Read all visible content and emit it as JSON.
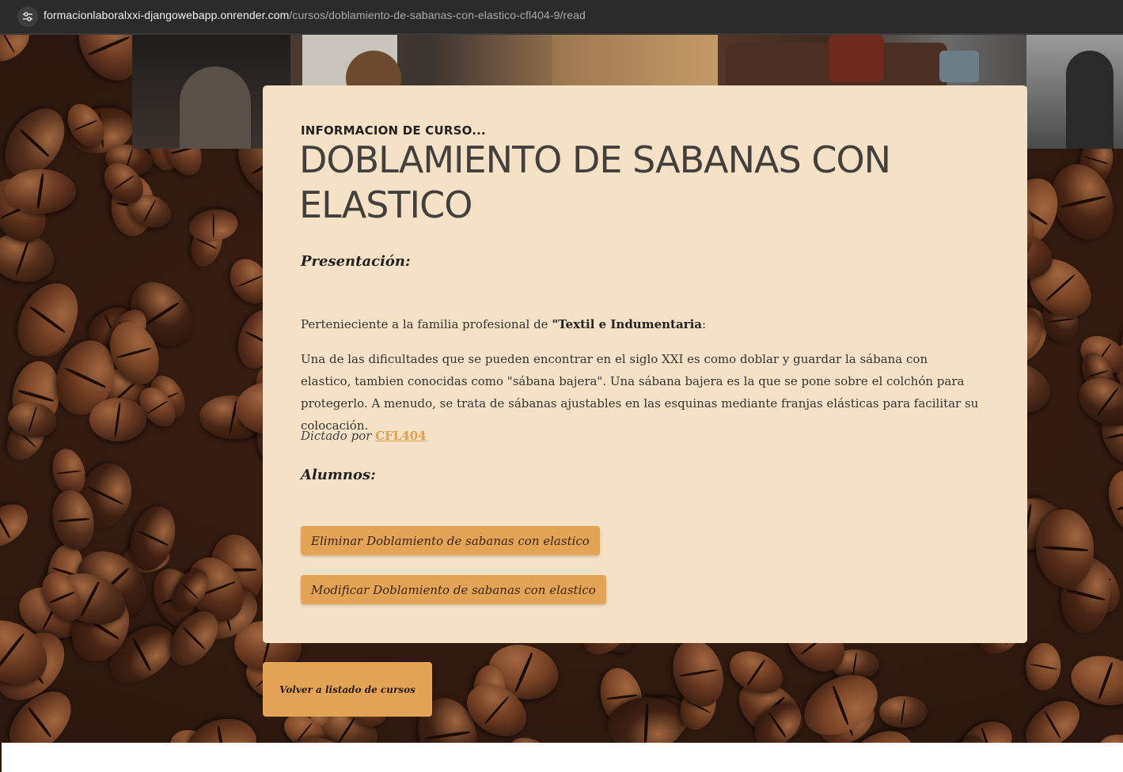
{
  "browser": {
    "url_host": "formacionlaboralxxi-djangowebapp.onrender.com",
    "url_path": "/cursos/doblamiento-de-sabanas-con-elastico-cfl404-9/read"
  },
  "course": {
    "eyebrow": "INFORMACION DE CURSO...",
    "title": "DOBLAMIENTO DE SABANAS CON ELASTICO",
    "presentation_heading": "Presentación:",
    "family_prefix": "Pertenieciente a la familia profesional de ",
    "family_name": "\"Textil e Indumentaria",
    "family_suffix": ":",
    "description": "Una de las dificultades que se pueden encontrar en el siglo XXI es como doblar y guardar la sábana con elastico, tambien conocidas como \"sábana bajera\". Una sábana bajera es la que se pone sobre el colchón para protegerlo. A menudo, se trata de sábanas ajustables en las esquinas mediante franjas elásticas para facilitar su colocación.",
    "taught_by_label": "Dictado por ",
    "taught_by_link": "CFL404",
    "students_heading": "Alumnos:"
  },
  "actions": {
    "delete_label": "Eliminar Doblamiento de sabanas con elastico",
    "edit_label": "Modificar Doblamiento de sabanas con elastico",
    "back_label": "Volver a listado de cursos"
  },
  "colors": {
    "card_bg": "#f5e1c5",
    "accent": "#e3a555",
    "link": "#e0a04f"
  }
}
